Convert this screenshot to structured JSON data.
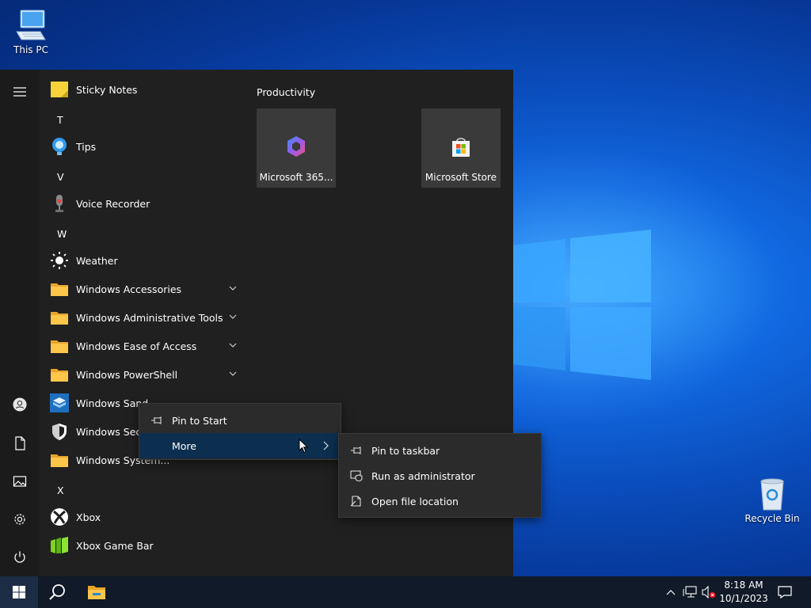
{
  "desktop": {
    "icons": [
      {
        "label": "This PC"
      },
      {
        "label": "Recycle Bin"
      }
    ]
  },
  "start_menu": {
    "apps": [
      {
        "type": "app",
        "label": "Sticky Notes",
        "icon": "sticky-notes-icon"
      },
      {
        "type": "letter",
        "label": "T"
      },
      {
        "type": "app",
        "label": "Tips",
        "icon": "tips-icon"
      },
      {
        "type": "letter",
        "label": "V"
      },
      {
        "type": "app",
        "label": "Voice Recorder",
        "icon": "microphone-icon"
      },
      {
        "type": "letter",
        "label": "W"
      },
      {
        "type": "app",
        "label": "Weather",
        "icon": "sun-icon"
      },
      {
        "type": "folder",
        "label": "Windows Accessories",
        "icon": "folder-icon"
      },
      {
        "type": "folder",
        "label": "Windows Administrative Tools",
        "icon": "folder-icon"
      },
      {
        "type": "folder",
        "label": "Windows Ease of Access",
        "icon": "folder-icon"
      },
      {
        "type": "folder",
        "label": "Windows PowerShell",
        "icon": "folder-icon"
      },
      {
        "type": "app",
        "label": "Windows Sandbox",
        "icon": "sandbox-icon"
      },
      {
        "type": "app",
        "label": "Windows Security",
        "icon": "shield-icon"
      },
      {
        "type": "app",
        "label": "Windows System...",
        "icon": "folder-icon"
      },
      {
        "type": "letter",
        "label": "X"
      },
      {
        "type": "app",
        "label": "Xbox",
        "icon": "xbox-icon"
      },
      {
        "type": "app",
        "label": "Xbox Game Bar",
        "icon": "game-bar-icon"
      }
    ],
    "visible_names": [
      "Windows Sand",
      "Windows Secu"
    ],
    "tiles_group": "Productivity",
    "tiles": [
      {
        "label": "Microsoft 365...",
        "icon": "microsoft-365-icon"
      },
      {
        "label": "Microsoft Store",
        "icon": "store-icon"
      }
    ]
  },
  "context_menu": {
    "items": [
      {
        "label": "Pin to Start",
        "icon": "pin-icon"
      },
      {
        "label": "More",
        "icon": "chevron-right-icon"
      }
    ]
  },
  "submenu": {
    "items": [
      {
        "label": "Pin to taskbar",
        "icon": "pin-icon"
      },
      {
        "label": "Run as administrator",
        "icon": "admin-shield-icon"
      },
      {
        "label": "Open file location",
        "icon": "file-location-icon"
      }
    ]
  },
  "taskbar": {
    "time": "8:18 AM",
    "date": "10/1/2023"
  },
  "colors": {
    "accent": "#0078d4",
    "start_bg": "#202020",
    "taskbar_bg": "#101a28",
    "menu_bg": "#2b2b2b",
    "highlight": "#0c2f4f"
  }
}
